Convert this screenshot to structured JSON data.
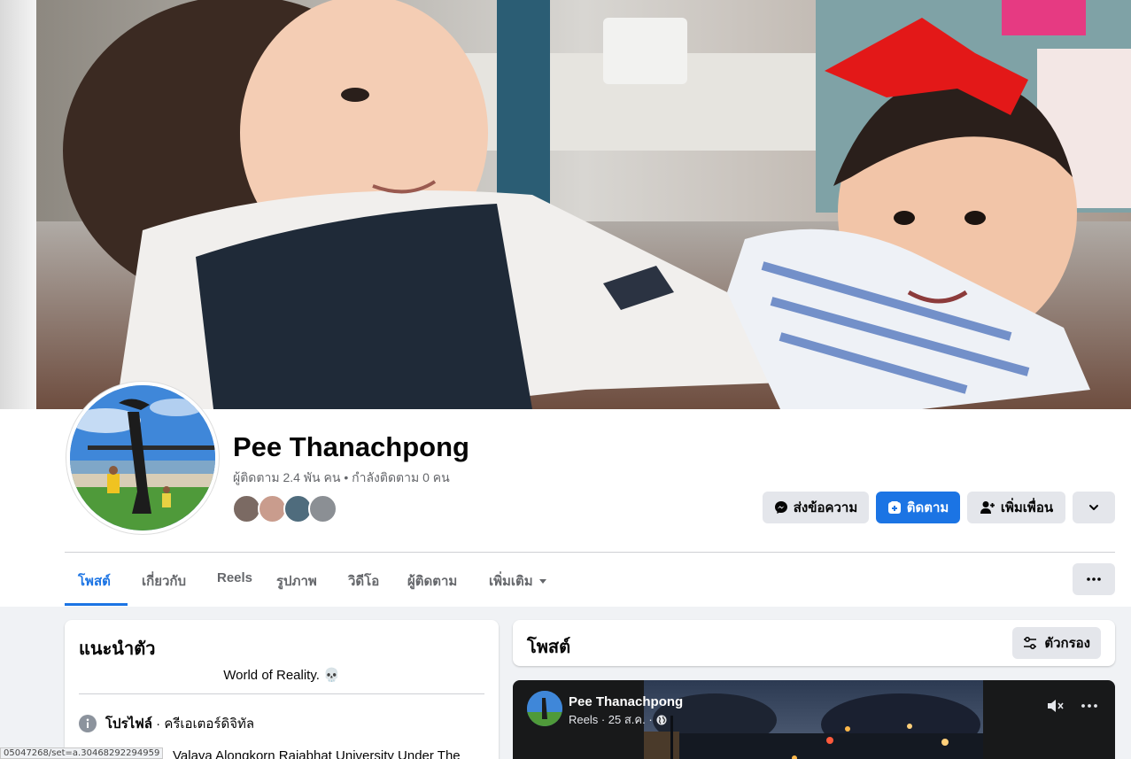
{
  "profile": {
    "name": "Pee Thanachpong",
    "followers_text": "ผู้ติดตาม 2.4 พัน คน • กำลังติดตาม 0 คน"
  },
  "actions": {
    "message_label": "ส่งข้อความ",
    "follow_label": "ติดตาม",
    "add_friend_label": "เพิ่มเพื่อน"
  },
  "tabs": [
    {
      "label": "โพสต์"
    },
    {
      "label": "เกี่ยวกับ"
    },
    {
      "label": "Reels"
    },
    {
      "label": "รูปภาพ"
    },
    {
      "label": "วิดีโอ"
    },
    {
      "label": "ผู้ติดตาม"
    },
    {
      "label": "เพิ่มเติม"
    }
  ],
  "intro": {
    "title": "แนะนำตัว",
    "bio": "World of Reality. 💀",
    "profile_label": "โปรไฟล์",
    "profile_value": " · ครีเอเตอร์ดิจิทัล",
    "university_text": "Valaya Alongkorn Rajabhat University Under The"
  },
  "posts": {
    "title": "โพสต์",
    "filter_label": "ตัวกรอง"
  },
  "reel_post": {
    "author": "Pee Thanachpong",
    "meta": "Reels · 25 ส.ค. ·"
  },
  "status_url": "05047268/set=a.30468292294959",
  "colors": {
    "accent": "#1b74e4",
    "button_gray": "#e4e6eb",
    "text_secondary": "#65676b"
  }
}
